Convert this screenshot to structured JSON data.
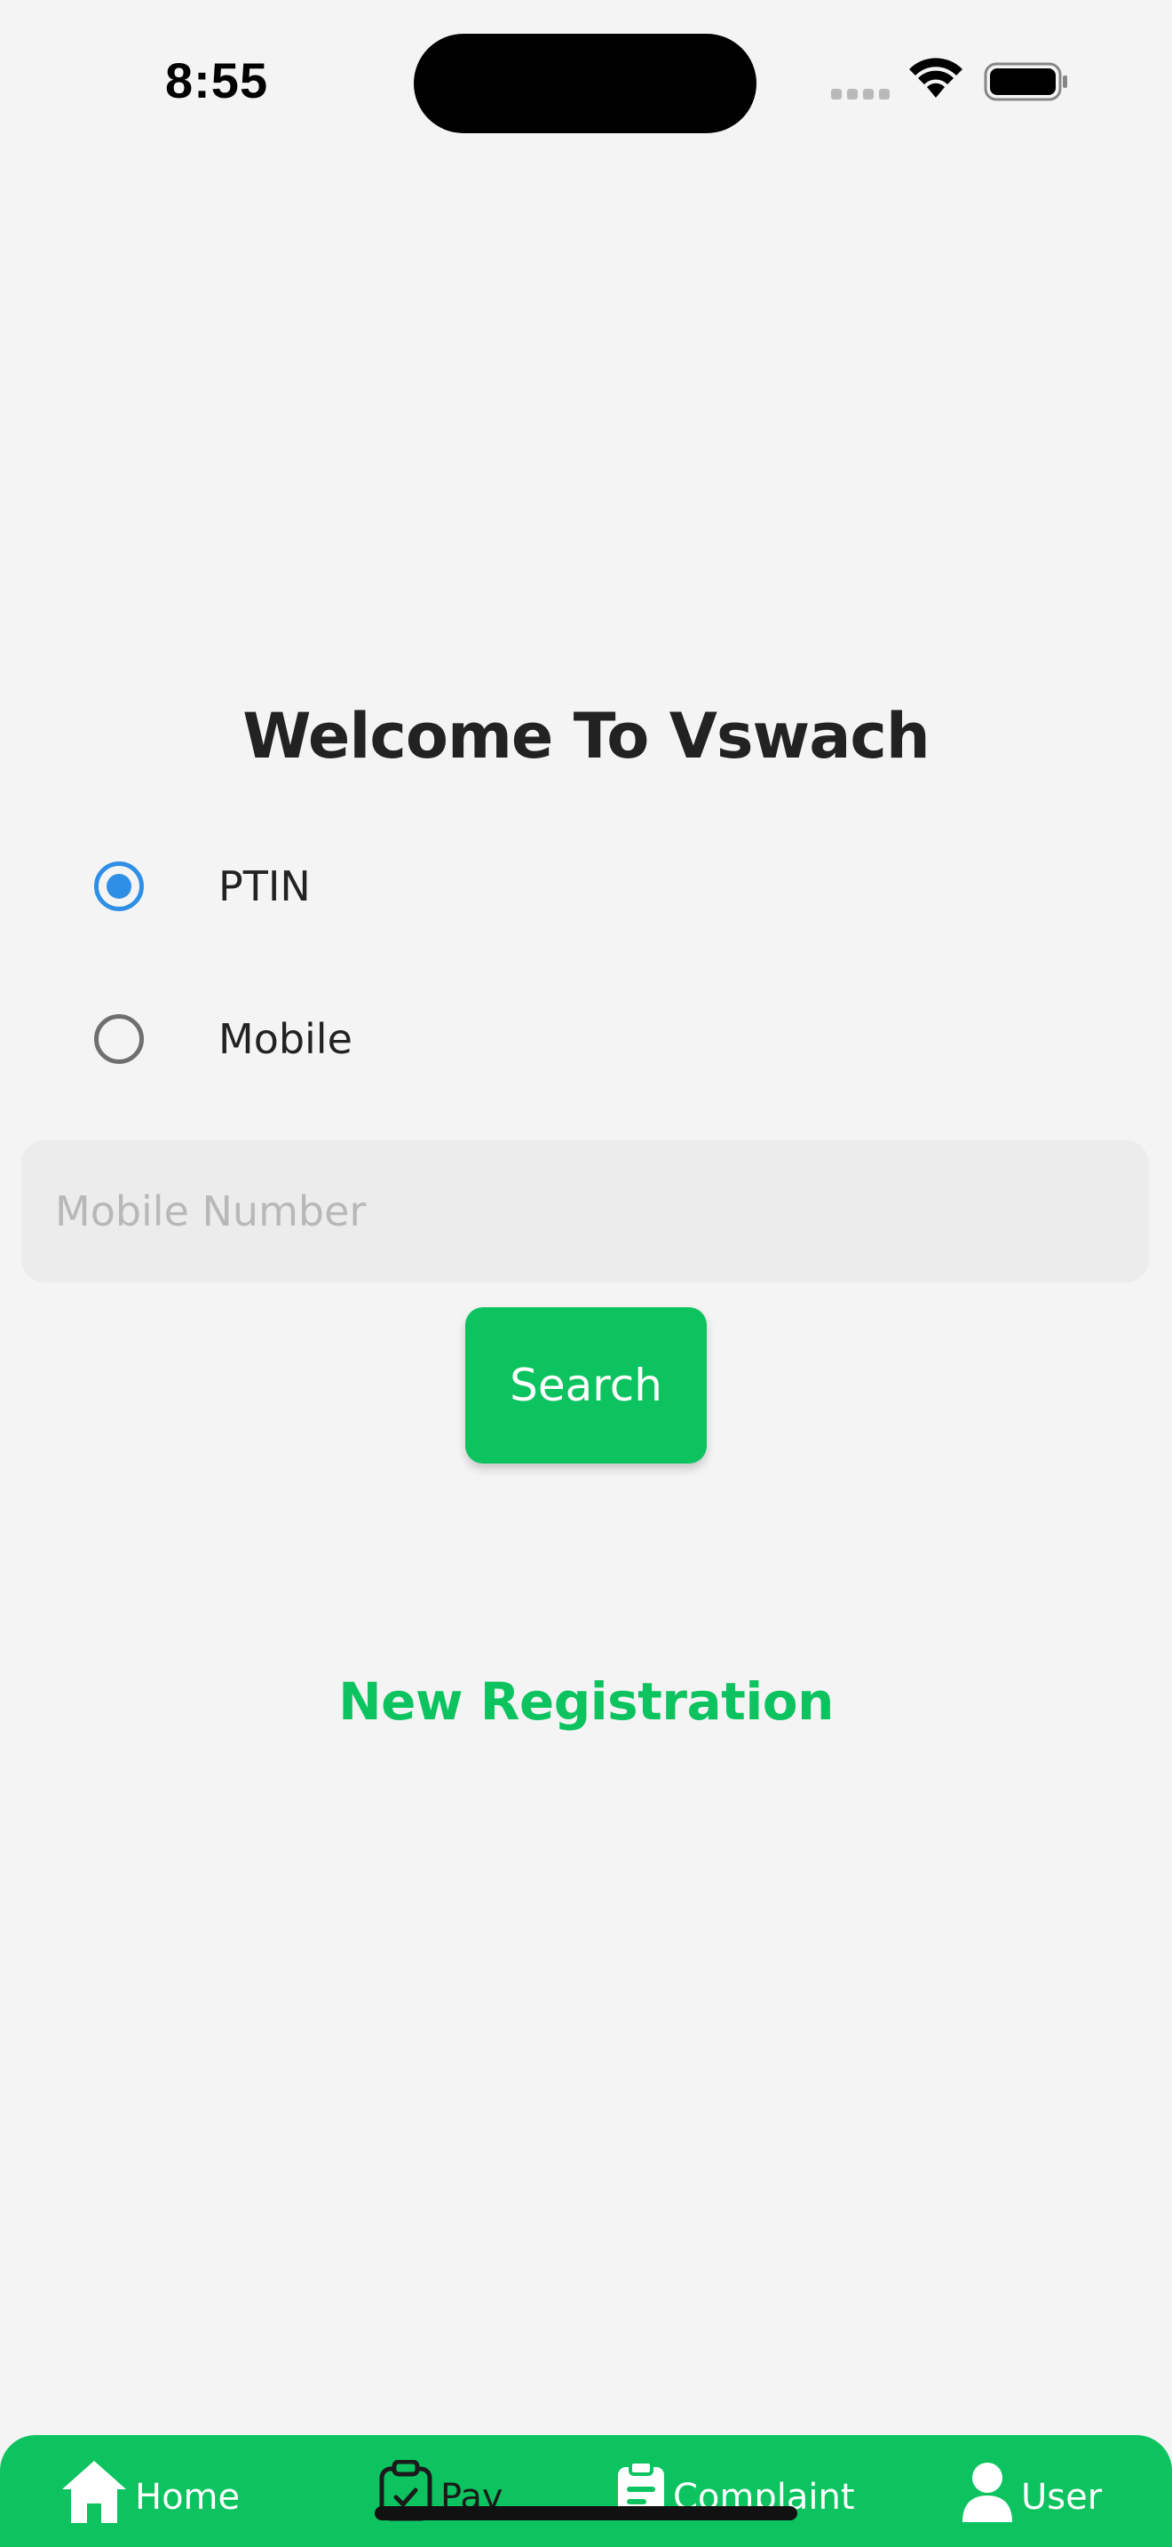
{
  "status_bar": {
    "time": "8:55"
  },
  "main": {
    "title": "Welcome To Vswach",
    "radio_options": [
      {
        "label": "PTIN",
        "selected": true
      },
      {
        "label": "Mobile",
        "selected": false
      }
    ],
    "input": {
      "placeholder": "Mobile Number",
      "value": ""
    },
    "search_label": "Search",
    "new_registration_label": "New Registration"
  },
  "bottom_nav": {
    "items": [
      {
        "label": "Home",
        "icon": "home-icon"
      },
      {
        "label": "Pay",
        "icon": "clipboard-check-icon"
      },
      {
        "label": "Complaint",
        "icon": "clipboard-list-icon"
      },
      {
        "label": "User",
        "icon": "user-icon"
      }
    ]
  },
  "colors": {
    "accent": "#0cc35f",
    "radio_selected": "#2f8fe6",
    "background": "#f4f4f4"
  }
}
